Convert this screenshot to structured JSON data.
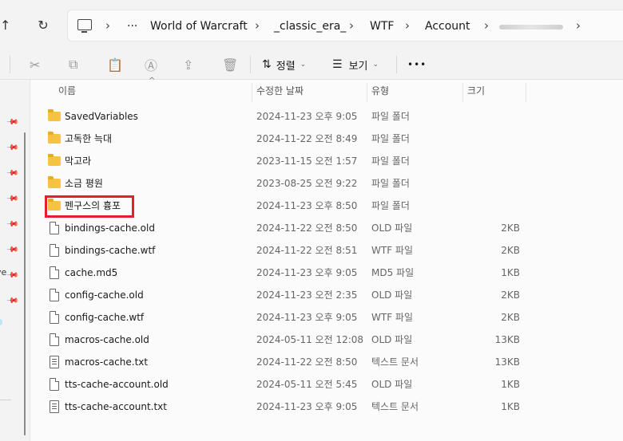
{
  "address_bar": {
    "up_glyph": "↑",
    "refresh_glyph": "↻",
    "more_glyph": "···",
    "breadcrumbs": [
      "World of Warcraft",
      "_classic_era_",
      "WTF",
      "Account"
    ]
  },
  "toolbar": {
    "sort_label": "정렬",
    "view_label": "보기",
    "more_glyph": "•••"
  },
  "columns": {
    "name": "이름",
    "date": "수정한 날짜",
    "type": "유형",
    "size": "크기"
  },
  "files": [
    {
      "name": "SavedVariables",
      "date": "2024-11-23 오후 9:05",
      "type": "파일 폴더",
      "size": "",
      "icon": "folder-icon"
    },
    {
      "name": "고독한 늑대",
      "date": "2024-11-22 오전 8:49",
      "type": "파일 폴더",
      "size": "",
      "icon": "folder-icon"
    },
    {
      "name": "막고라",
      "date": "2023-11-15 오전 1:57",
      "type": "파일 폴더",
      "size": "",
      "icon": "folder-icon"
    },
    {
      "name": "소금 평원",
      "date": "2023-08-25 오전 9:22",
      "type": "파일 폴더",
      "size": "",
      "icon": "folder-icon"
    },
    {
      "name": "펜구스의 흉포",
      "date": "2024-11-23 오후 8:50",
      "type": "파일 폴더",
      "size": "",
      "icon": "folder-icon"
    },
    {
      "name": "bindings-cache.old",
      "date": "2024-11-22 오전 8:50",
      "type": "OLD 파일",
      "size": "2KB",
      "icon": "file-icon"
    },
    {
      "name": "bindings-cache.wtf",
      "date": "2024-11-22 오전 8:51",
      "type": "WTF 파일",
      "size": "2KB",
      "icon": "file-icon"
    },
    {
      "name": "cache.md5",
      "date": "2024-11-23 오후 9:05",
      "type": "MD5 파일",
      "size": "1KB",
      "icon": "file-icon"
    },
    {
      "name": "config-cache.old",
      "date": "2024-11-23 오전 2:35",
      "type": "OLD 파일",
      "size": "2KB",
      "icon": "file-icon"
    },
    {
      "name": "config-cache.wtf",
      "date": "2024-11-23 오후 9:05",
      "type": "WTF 파일",
      "size": "2KB",
      "icon": "file-icon"
    },
    {
      "name": "macros-cache.old",
      "date": "2024-05-11 오전 12:08",
      "type": "OLD 파일",
      "size": "13KB",
      "icon": "file-icon"
    },
    {
      "name": "macros-cache.txt",
      "date": "2024-11-22 오전 8:50",
      "type": "텍스트 문서",
      "size": "13KB",
      "icon": "txt-icon"
    },
    {
      "name": "tts-cache-account.old",
      "date": "2024-05-11 오전 5:45",
      "type": "OLD 파일",
      "size": "1KB",
      "icon": "file-icon"
    },
    {
      "name": "tts-cache-account.txt",
      "date": "2024-11-23 오후 9:05",
      "type": "텍스트 문서",
      "size": "1KB",
      "icon": "txt-icon"
    }
  ],
  "colors": {
    "highlight": "#e0202a",
    "folder": "#f5c242"
  }
}
